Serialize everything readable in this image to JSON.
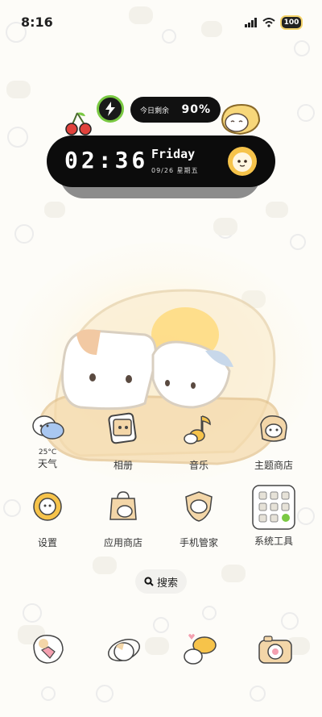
{
  "status_bar": {
    "time": "8:16",
    "battery": "100"
  },
  "widget": {
    "battery_label": "今日剩余",
    "battery_value": "90%",
    "time": "02:36",
    "day": "Friday",
    "date": "09/26  星期五"
  },
  "apps": [
    {
      "label": "天气",
      "sublabel": "25°C",
      "icon": "weather-icon"
    },
    {
      "label": "相册",
      "icon": "gallery-icon"
    },
    {
      "label": "音乐",
      "icon": "music-icon"
    },
    {
      "label": "主题商店",
      "icon": "theme-store-icon"
    },
    {
      "label": "设置",
      "icon": "settings-icon"
    },
    {
      "label": "应用商店",
      "icon": "app-store-icon"
    },
    {
      "label": "手机管家",
      "icon": "phone-manager-icon"
    },
    {
      "label": "系统工具",
      "icon": "system-tools-icon"
    }
  ],
  "search": {
    "label": "搜索"
  },
  "dock": [
    {
      "icon": "phone-icon"
    },
    {
      "icon": "contacts-icon"
    },
    {
      "icon": "messages-icon"
    },
    {
      "icon": "camera-icon"
    }
  ],
  "colors": {
    "accent_green": "#7ac943",
    "widget_black": "#0c0c0c",
    "cream": "#f6e3b0"
  }
}
